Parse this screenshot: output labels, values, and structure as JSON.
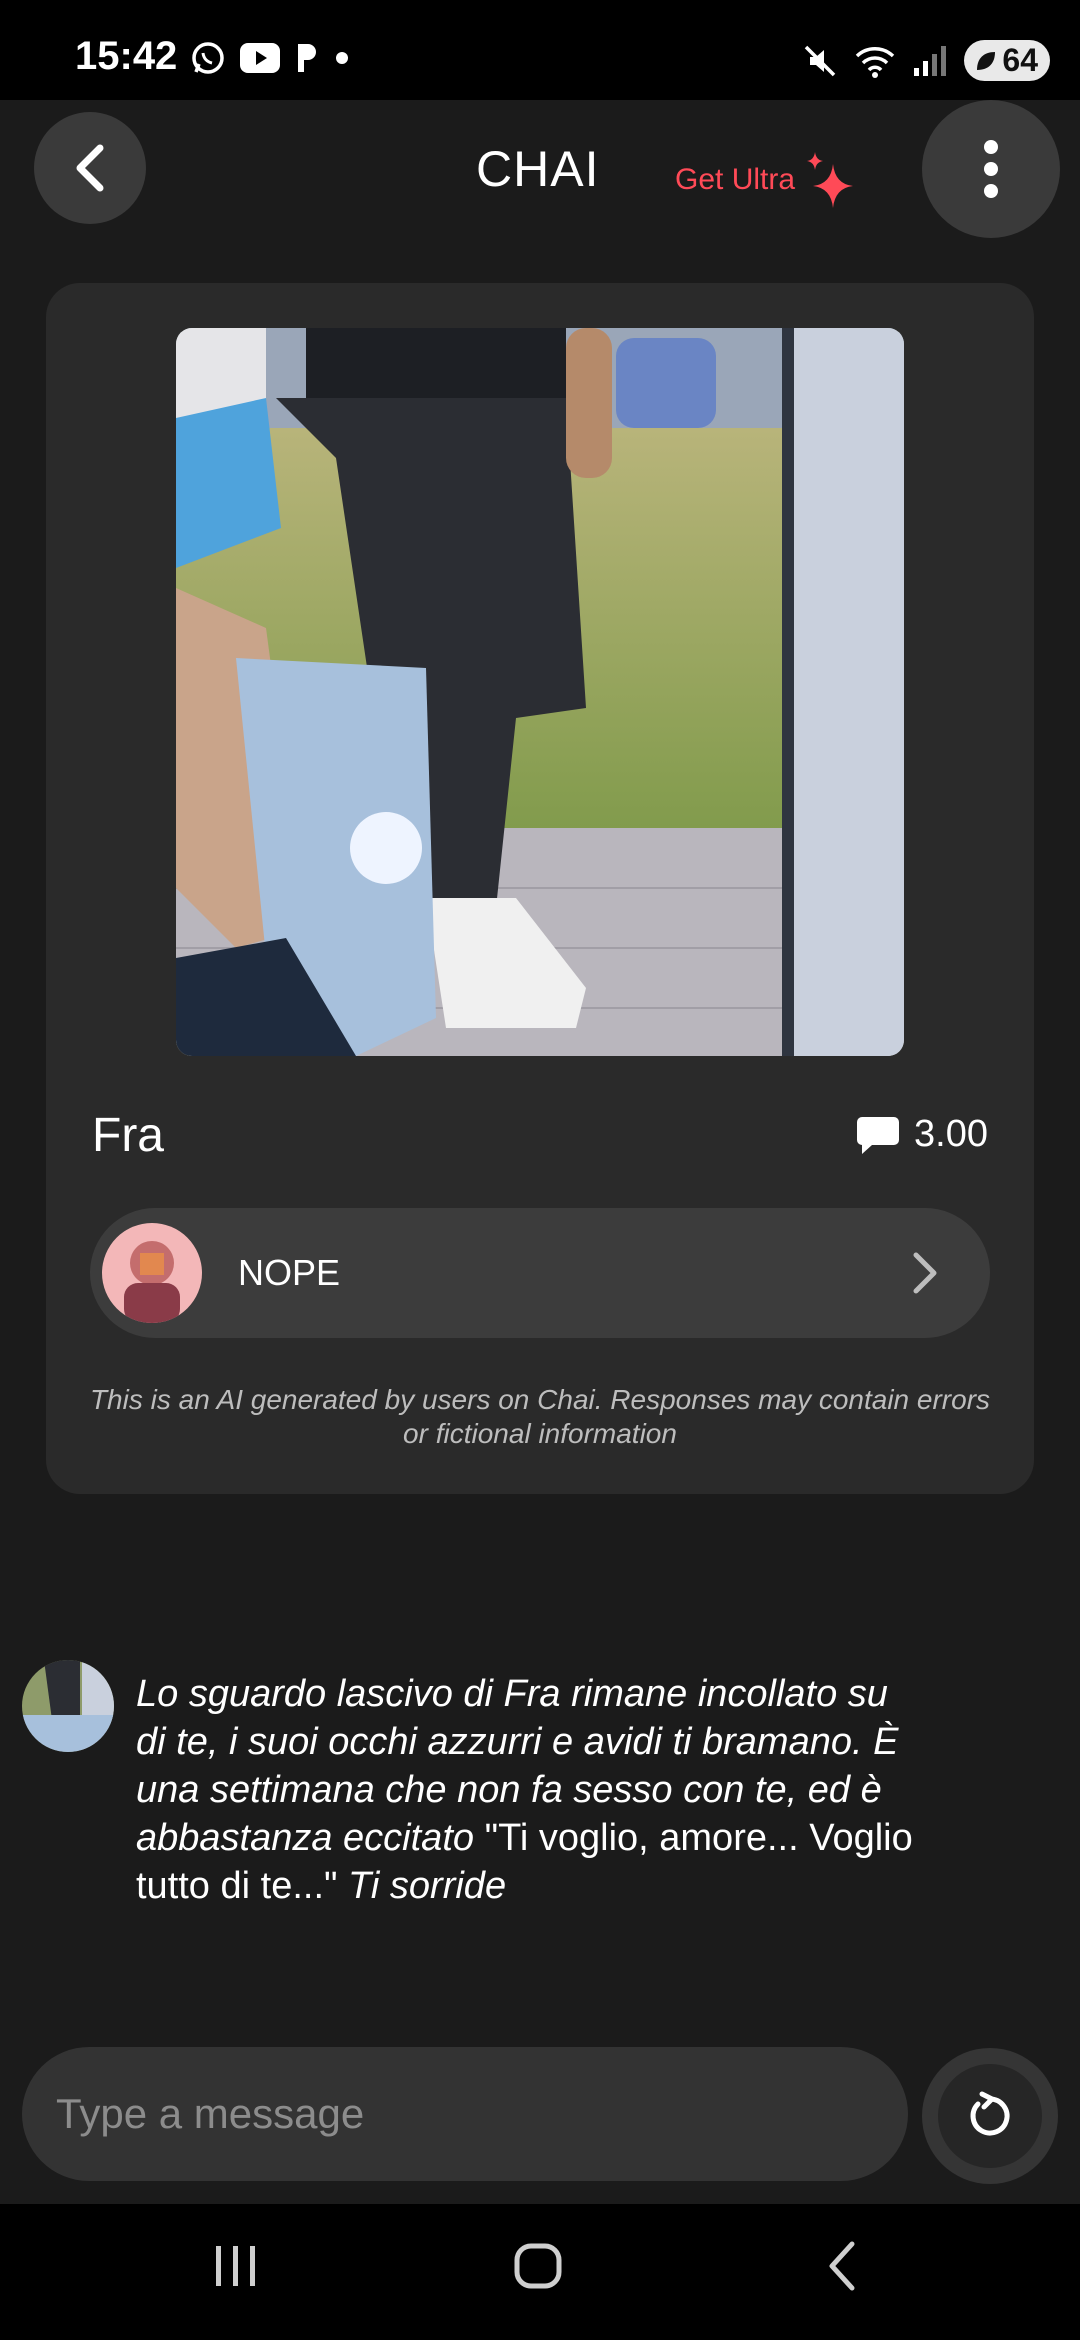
{
  "status_bar": {
    "time": "15:42",
    "battery": "64",
    "icons_left": [
      "whatsapp-icon",
      "youtube-icon",
      "tasker-icon",
      "dot-icon"
    ],
    "icons_right": [
      "mute-icon",
      "wifi-icon",
      "signal-icon",
      "battery-icon"
    ]
  },
  "header": {
    "title": "CHAI",
    "get_ultra": "Get Ultra",
    "accent_color": "#ff4a57"
  },
  "profile": {
    "name": "Fra",
    "rating": "3.00",
    "creator": "NOPE",
    "disclaimer": "This is an AI generated by users on Chai. Responses may contain errors or fictional information"
  },
  "message": {
    "part1": "Lo sguardo lascivo di Fra rimane incollato su di te, i suoi occhi azzurri e avidi ti bramano. È una settimana che non fa sesso con te, ed è abbastanza eccitato",
    "part2": " \"Ti voglio, amore... Voglio tutto di te...\" ",
    "part3": "Ti sorride"
  },
  "input": {
    "placeholder": "Type a message"
  }
}
